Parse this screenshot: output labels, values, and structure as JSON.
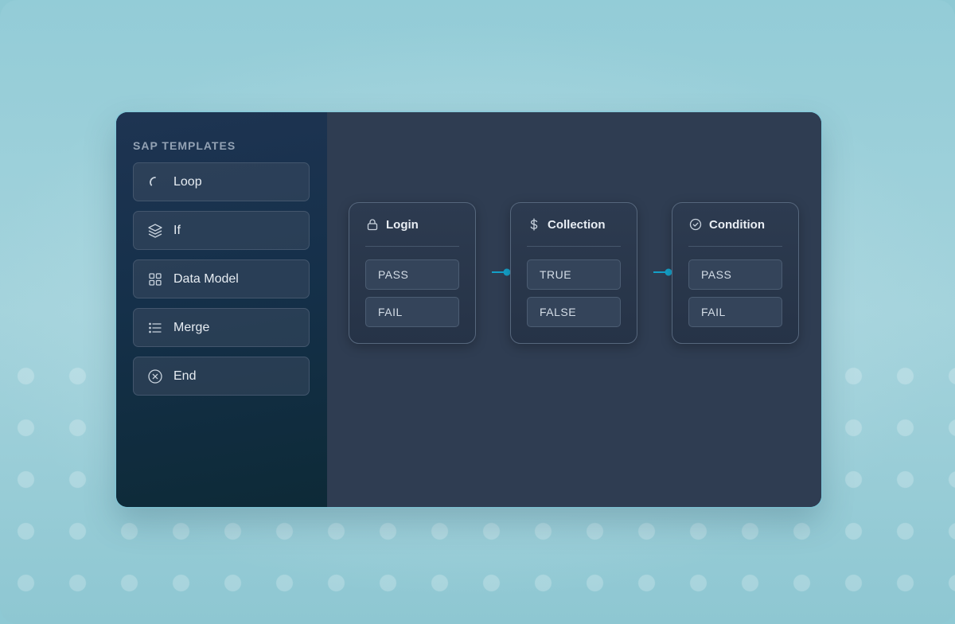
{
  "sidebar": {
    "title": "SAP TEMPLATES",
    "items": [
      {
        "label": "Loop",
        "icon": "loop-icon"
      },
      {
        "label": "If",
        "icon": "layers-icon"
      },
      {
        "label": "Data Model",
        "icon": "grid-icon"
      },
      {
        "label": "Merge",
        "icon": "list-icon"
      },
      {
        "label": "End",
        "icon": "close-circle-icon"
      }
    ]
  },
  "nodes": [
    {
      "title": "Login",
      "icon": "lock-icon",
      "ports": [
        "PASS",
        "FAIL"
      ]
    },
    {
      "title": "Collection",
      "icon": "dollar-icon",
      "ports": [
        "TRUE",
        "FALSE"
      ]
    },
    {
      "title": "Condition",
      "icon": "check-circle-icon",
      "ports": [
        "PASS",
        "FAIL"
      ]
    }
  ],
  "colors": {
    "accent": "#14a0c8",
    "canvas_bg": "#2f3d52",
    "sidebar_bg": "#15304a"
  }
}
